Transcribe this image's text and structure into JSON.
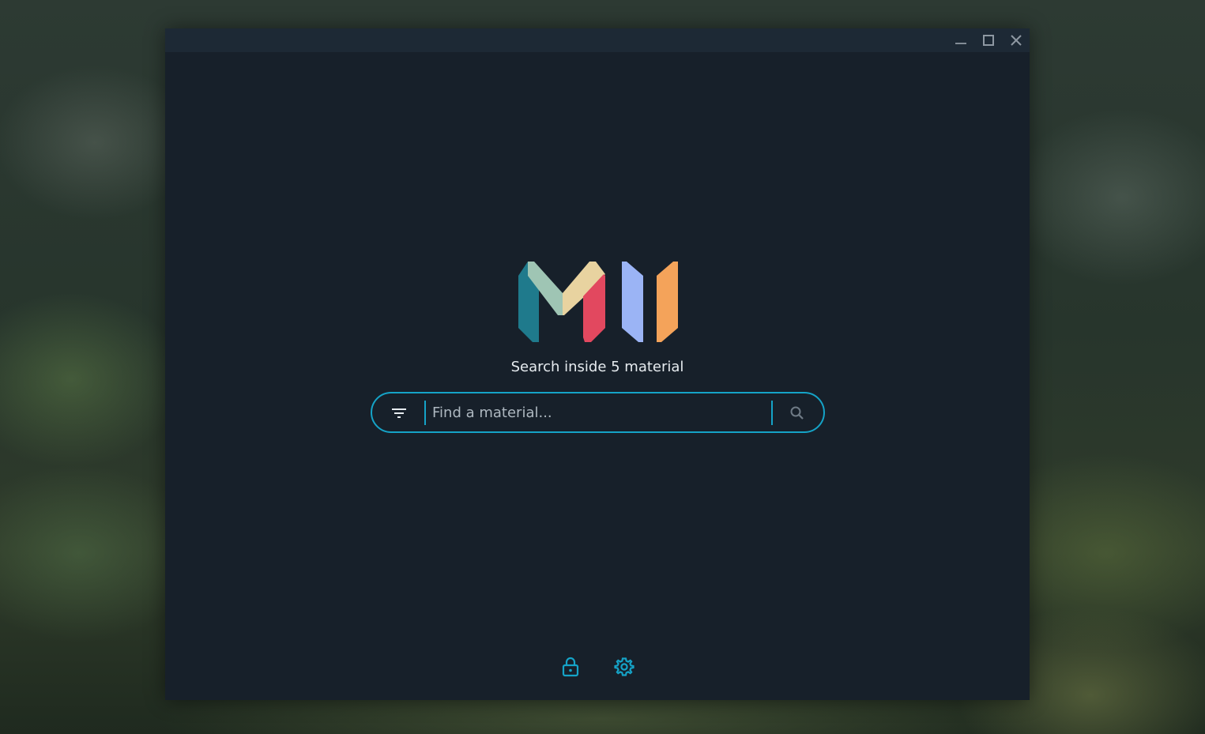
{
  "window": {
    "controls": [
      {
        "name": "minimize-icon"
      },
      {
        "name": "maximize-icon"
      },
      {
        "name": "close-icon"
      }
    ]
  },
  "logo": {
    "colors": {
      "teal": "#1f7a8c",
      "mint": "#9fc5b4",
      "sand": "#e8d3a0",
      "red": "#e2485f",
      "periwinkle": "#9bb4f5",
      "orange": "#f4a35a"
    }
  },
  "main": {
    "subtitle": "Search inside 5 material"
  },
  "search": {
    "placeholder": "Find a material...",
    "value": "",
    "filter_icon": "filter-icon",
    "search_icon": "search-icon"
  },
  "footer": {
    "icons": [
      "lock-icon",
      "gear-icon"
    ]
  },
  "theme": {
    "window_bg": "#17202a",
    "titlebar_bg": "#1d2935",
    "accent": "#15a3c7",
    "text": "#e6ebef"
  }
}
